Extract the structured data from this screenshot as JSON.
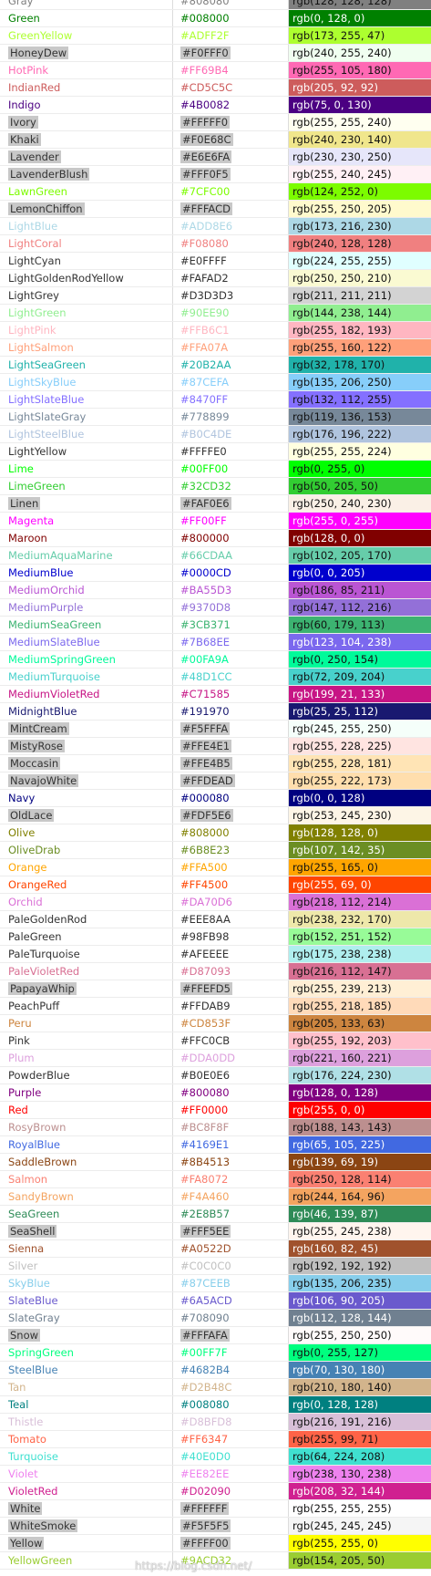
{
  "colors": [
    {
      "name": "Gray",
      "hex": "#808080",
      "rgb": "rgb(128, 128, 128)"
    },
    {
      "name": "Green",
      "hex": "#008000",
      "rgb": "rgb(0, 128, 0)"
    },
    {
      "name": "GreenYellow",
      "hex": "#ADFF2F",
      "rgb": "rgb(173, 255, 47)"
    },
    {
      "name": "HoneyDew",
      "hex": "#F0FFF0",
      "rgb": "rgb(240, 255, 240)"
    },
    {
      "name": "HotPink",
      "hex": "#FF69B4",
      "rgb": "rgb(255, 105, 180)"
    },
    {
      "name": "IndianRed",
      "hex": "#CD5C5C",
      "rgb": "rgb(205, 92, 92)"
    },
    {
      "name": "Indigo",
      "hex": "#4B0082",
      "rgb": "rgb(75, 0, 130)"
    },
    {
      "name": "Ivory",
      "hex": "#FFFFF0",
      "rgb": "rgb(255, 255, 240)"
    },
    {
      "name": "Khaki",
      "hex": "#F0E68C",
      "rgb": "rgb(240, 230, 140)"
    },
    {
      "name": "Lavender",
      "hex": "#E6E6FA",
      "rgb": "rgb(230, 230, 250)"
    },
    {
      "name": "LavenderBlush",
      "hex": "#FFF0F5",
      "rgb": "rgb(255, 240, 245)"
    },
    {
      "name": "LawnGreen",
      "hex": "#7CFC00",
      "rgb": "rgb(124, 252, 0)"
    },
    {
      "name": "LemonChiffon",
      "hex": "#FFFACD",
      "rgb": "rgb(255, 250, 205)"
    },
    {
      "name": "LightBlue",
      "hex": "#ADD8E6",
      "rgb": "rgb(173, 216, 230)"
    },
    {
      "name": "LightCoral",
      "hex": "#F08080",
      "rgb": "rgb(240, 128, 128)"
    },
    {
      "name": "LightCyan",
      "hex": "#E0FFFF",
      "rgb": "rgb(224, 255, 255)"
    },
    {
      "name": "LightGoldenRodYellow",
      "hex": "#FAFAD2",
      "rgb": "rgb(250, 250, 210)"
    },
    {
      "name": "LightGrey",
      "hex": "#D3D3D3",
      "rgb": "rgb(211, 211, 211)"
    },
    {
      "name": "LightGreen",
      "hex": "#90EE90",
      "rgb": "rgb(144, 238, 144)"
    },
    {
      "name": "LightPink",
      "hex": "#FFB6C1",
      "rgb": "rgb(255, 182, 193)"
    },
    {
      "name": "LightSalmon",
      "hex": "#FFA07A",
      "rgb": "rgb(255, 160, 122)"
    },
    {
      "name": "LightSeaGreen",
      "hex": "#20B2AA",
      "rgb": "rgb(32, 178, 170)"
    },
    {
      "name": "LightSkyBlue",
      "hex": "#87CEFA",
      "rgb": "rgb(135, 206, 250)"
    },
    {
      "name": "LightSlateBlue",
      "hex": "#8470FF",
      "rgb": "rgb(132, 112, 255)"
    },
    {
      "name": "LightSlateGray",
      "hex": "#778899",
      "rgb": "rgb(119, 136, 153)"
    },
    {
      "name": "LightSteelBlue",
      "hex": "#B0C4DE",
      "rgb": "rgb(176, 196, 222)"
    },
    {
      "name": "LightYellow",
      "hex": "#FFFFE0",
      "rgb": "rgb(255, 255, 224)"
    },
    {
      "name": "Lime",
      "hex": "#00FF00",
      "rgb": "rgb(0, 255, 0)"
    },
    {
      "name": "LimeGreen",
      "hex": "#32CD32",
      "rgb": "rgb(50, 205, 50)"
    },
    {
      "name": "Linen",
      "hex": "#FAF0E6",
      "rgb": "rgb(250, 240, 230)"
    },
    {
      "name": "Magenta",
      "hex": "#FF00FF",
      "rgb": "rgb(255, 0, 255)"
    },
    {
      "name": "Maroon",
      "hex": "#800000",
      "rgb": "rgb(128, 0, 0)"
    },
    {
      "name": "MediumAquaMarine",
      "hex": "#66CDAA",
      "rgb": "rgb(102, 205, 170)"
    },
    {
      "name": "MediumBlue",
      "hex": "#0000CD",
      "rgb": "rgb(0, 0, 205)"
    },
    {
      "name": "MediumOrchid",
      "hex": "#BA55D3",
      "rgb": "rgb(186, 85, 211)"
    },
    {
      "name": "MediumPurple",
      "hex": "#9370D8",
      "rgb": "rgb(147, 112, 216)"
    },
    {
      "name": "MediumSeaGreen",
      "hex": "#3CB371",
      "rgb": "rgb(60, 179, 113)"
    },
    {
      "name": "MediumSlateBlue",
      "hex": "#7B68EE",
      "rgb": "rgb(123, 104, 238)"
    },
    {
      "name": "MediumSpringGreen",
      "hex": "#00FA9A",
      "rgb": "rgb(0, 250, 154)"
    },
    {
      "name": "MediumTurquoise",
      "hex": "#48D1CC",
      "rgb": "rgb(72, 209, 204)"
    },
    {
      "name": "MediumVioletRed",
      "hex": "#C71585",
      "rgb": "rgb(199, 21, 133)"
    },
    {
      "name": "MidnightBlue",
      "hex": "#191970",
      "rgb": "rgb(25, 25, 112)"
    },
    {
      "name": "MintCream",
      "hex": "#F5FFFA",
      "rgb": "rgb(245, 255, 250)"
    },
    {
      "name": "MistyRose",
      "hex": "#FFE4E1",
      "rgb": "rgb(255, 228, 225)"
    },
    {
      "name": "Moccasin",
      "hex": "#FFE4B5",
      "rgb": "rgb(255, 228, 181)"
    },
    {
      "name": "NavajoWhite",
      "hex": "#FFDEAD",
      "rgb": "rgb(255, 222, 173)"
    },
    {
      "name": "Navy",
      "hex": "#000080",
      "rgb": "rgb(0, 0, 128)"
    },
    {
      "name": "OldLace",
      "hex": "#FDF5E6",
      "rgb": "rgb(253, 245, 230)"
    },
    {
      "name": "Olive",
      "hex": "#808000",
      "rgb": "rgb(128, 128, 0)"
    },
    {
      "name": "OliveDrab",
      "hex": "#6B8E23",
      "rgb": "rgb(107, 142, 35)"
    },
    {
      "name": "Orange",
      "hex": "#FFA500",
      "rgb": "rgb(255, 165, 0)"
    },
    {
      "name": "OrangeRed",
      "hex": "#FF4500",
      "rgb": "rgb(255, 69, 0)"
    },
    {
      "name": "Orchid",
      "hex": "#DA70D6",
      "rgb": "rgb(218, 112, 214)"
    },
    {
      "name": "PaleGoldenRod",
      "hex": "#EEE8AA",
      "rgb": "rgb(238, 232, 170)"
    },
    {
      "name": "PaleGreen",
      "hex": "#98FB98",
      "rgb": "rgb(152, 251, 152)"
    },
    {
      "name": "PaleTurquoise",
      "hex": "#AFEEEE",
      "rgb": "rgb(175, 238, 238)"
    },
    {
      "name": "PaleVioletRed",
      "hex": "#D87093",
      "rgb": "rgb(216, 112, 147)"
    },
    {
      "name": "PapayaWhip",
      "hex": "#FFEFD5",
      "rgb": "rgb(255, 239, 213)"
    },
    {
      "name": "PeachPuff",
      "hex": "#FFDAB9",
      "rgb": "rgb(255, 218, 185)"
    },
    {
      "name": "Peru",
      "hex": "#CD853F",
      "rgb": "rgb(205, 133, 63)"
    },
    {
      "name": "Pink",
      "hex": "#FFC0CB",
      "rgb": "rgb(255, 192, 203)"
    },
    {
      "name": "Plum",
      "hex": "#DDA0DD",
      "rgb": "rgb(221, 160, 221)"
    },
    {
      "name": "PowderBlue",
      "hex": "#B0E0E6",
      "rgb": "rgb(176, 224, 230)"
    },
    {
      "name": "Purple",
      "hex": "#800080",
      "rgb": "rgb(128, 0, 128)"
    },
    {
      "name": "Red",
      "hex": "#FF0000",
      "rgb": "rgb(255, 0, 0)"
    },
    {
      "name": "RosyBrown",
      "hex": "#BC8F8F",
      "rgb": "rgb(188, 143, 143)"
    },
    {
      "name": "RoyalBlue",
      "hex": "#4169E1",
      "rgb": "rgb(65, 105, 225)"
    },
    {
      "name": "SaddleBrown",
      "hex": "#8B4513",
      "rgb": "rgb(139, 69, 19)"
    },
    {
      "name": "Salmon",
      "hex": "#FA8072",
      "rgb": "rgb(250, 128, 114)"
    },
    {
      "name": "SandyBrown",
      "hex": "#F4A460",
      "rgb": "rgb(244, 164, 96)"
    },
    {
      "name": "SeaGreen",
      "hex": "#2E8B57",
      "rgb": "rgb(46, 139, 87)"
    },
    {
      "name": "SeaShell",
      "hex": "#FFF5EE",
      "rgb": "rgb(255, 245, 238)"
    },
    {
      "name": "Sienna",
      "hex": "#A0522D",
      "rgb": "rgb(160, 82, 45)"
    },
    {
      "name": "Silver",
      "hex": "#C0C0C0",
      "rgb": "rgb(192, 192, 192)"
    },
    {
      "name": "SkyBlue",
      "hex": "#87CEEB",
      "rgb": "rgb(135, 206, 235)"
    },
    {
      "name": "SlateBlue",
      "hex": "#6A5ACD",
      "rgb": "rgb(106, 90, 205)"
    },
    {
      "name": "SlateGray",
      "hex": "#708090",
      "rgb": "rgb(112, 128, 144)"
    },
    {
      "name": "Snow",
      "hex": "#FFFAFA",
      "rgb": "rgb(255, 250, 250)"
    },
    {
      "name": "SpringGreen",
      "hex": "#00FF7F",
      "rgb": "rgb(0, 255, 127)"
    },
    {
      "name": "SteelBlue",
      "hex": "#4682B4",
      "rgb": "rgb(70, 130, 180)"
    },
    {
      "name": "Tan",
      "hex": "#D2B48C",
      "rgb": "rgb(210, 180, 140)"
    },
    {
      "name": "Teal",
      "hex": "#008080",
      "rgb": "rgb(0, 128, 128)"
    },
    {
      "name": "Thistle",
      "hex": "#D8BFD8",
      "rgb": "rgb(216, 191, 216)"
    },
    {
      "name": "Tomato",
      "hex": "#FF6347",
      "rgb": "rgb(255, 99, 71)"
    },
    {
      "name": "Turquoise",
      "hex": "#40E0D0",
      "rgb": "rgb(64, 224, 208)"
    },
    {
      "name": "Violet",
      "hex": "#EE82EE",
      "rgb": "rgb(238, 130, 238)"
    },
    {
      "name": "VioletRed",
      "hex": "#D02090",
      "rgb": "rgb(208, 32, 144)"
    },
    {
      "name": "White",
      "hex": "#FFFFFF",
      "rgb": "rgb(255, 255, 255)"
    },
    {
      "name": "WhiteSmoke",
      "hex": "#F5F5F5",
      "rgb": "rgb(245, 245, 245)"
    },
    {
      "name": "Yellow",
      "hex": "#FFFF00",
      "rgb": "rgb(255, 255, 0)"
    },
    {
      "name": "YellowGreen",
      "hex": "#9ACD32",
      "rgb": "rgb(154, 205, 50)"
    }
  ],
  "watermark": "https://blog.csdn.net/"
}
